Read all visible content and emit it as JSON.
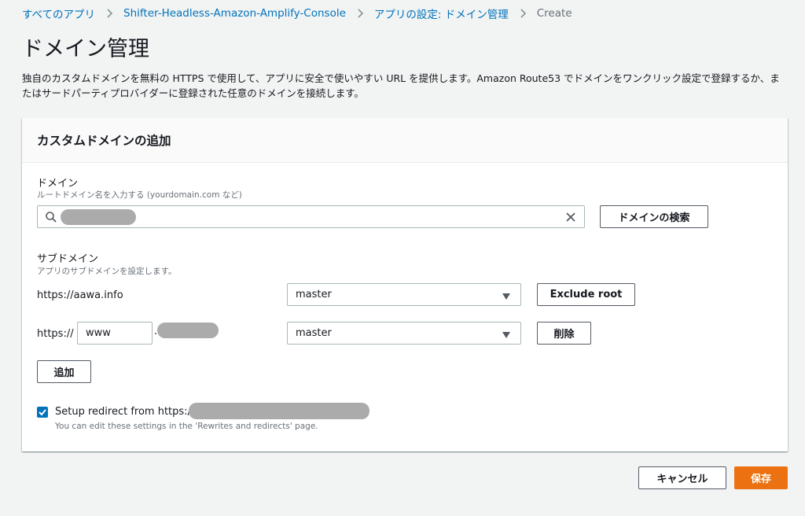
{
  "breadcrumb": {
    "items": [
      {
        "label": "すべてのアプリ"
      },
      {
        "label": "Shifter-Headless-Amazon-Amplify-Console"
      },
      {
        "label": "アプリの設定: ドメイン管理"
      },
      {
        "label": "Create"
      }
    ]
  },
  "page": {
    "title": "ドメイン管理",
    "description": "独自のカスタムドメインを無料の HTTPS で使用して、アプリに安全で使いやすい URL を提供します。Amazon Route53 でドメインをワンクリック設定で登録するか、またはサードパーティプロバイダーに登録された任意のドメインを接続します。"
  },
  "panel": {
    "title": "カスタムドメインの追加",
    "domain": {
      "label": "ドメイン",
      "hint": "ルートドメイン名を入力する (yourdomain.com など)",
      "search_button": "ドメインの検索"
    },
    "subdomain": {
      "label": "サブドメイン",
      "hint": "アプリのサブドメインを設定します。",
      "rows": [
        {
          "url": "https://aawa.info",
          "branch": "master",
          "action": "Exclude root"
        },
        {
          "prefix": "https://",
          "subdomain_value": "www",
          "separator": ".",
          "branch": "master",
          "action": "削除"
        }
      ],
      "add_button": "追加"
    },
    "redirect": {
      "checked": true,
      "label": "Setup redirect from https://",
      "hint": "You can edit these settings in the 'Rewrites and redirects' page."
    }
  },
  "footer": {
    "cancel": "キャンセル",
    "save": "保存"
  },
  "colors": {
    "link": "#0073bb",
    "primary": "#ec7211",
    "background": "#f2f3f3"
  }
}
